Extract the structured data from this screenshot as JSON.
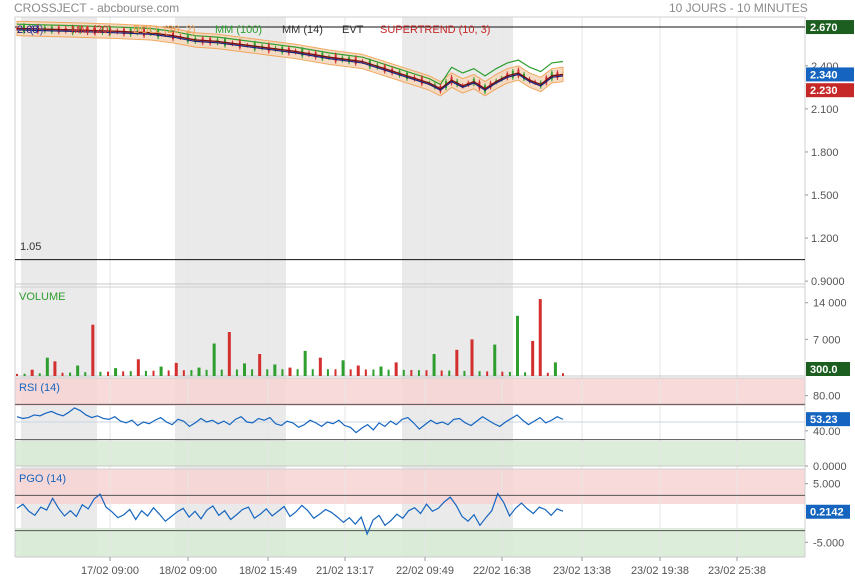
{
  "header": {
    "source": "CROSSJECT - abcbourse.com",
    "period": "10 JOURS - 10 MINUTES"
  },
  "indicators": [
    {
      "label": "2.68",
      "color": "#1a237e"
    },
    {
      "label": "(7)",
      "color": "#3949ab"
    },
    {
      "label": "MM (20)",
      "color": "#d32f2f"
    },
    {
      "label": "BOLL (20, 2)",
      "color": "#f0a050"
    },
    {
      "label": "MM (100)",
      "color": "#2e9e2e"
    },
    {
      "label": "MM (14)",
      "color": "#333333"
    },
    {
      "label": "EVT",
      "color": "#333333"
    },
    {
      "label": "SUPERTREND (10, 3)",
      "color": "#c62828"
    }
  ],
  "price_ref_label": "1.05",
  "price_badges": [
    {
      "value": "2.670",
      "bg": "#1b5e20"
    },
    {
      "value": "2.340",
      "bg": "#1565c0"
    },
    {
      "value": "2.230",
      "bg": "#c62828"
    }
  ],
  "volume_badge": {
    "value": "300.0",
    "bg": "#1b5e20"
  },
  "rsi_badge": {
    "value": "53.23",
    "bg": "#1565c0"
  },
  "pgo_badge": {
    "value": "0.2142",
    "bg": "#1565c0"
  },
  "panels": {
    "volume_title": "VOLUME",
    "rsi_title": "RSI (14)",
    "pgo_title": "PGO (14)"
  },
  "colors": {
    "up": "#2e9e2e",
    "down": "#d32f2f",
    "rsi_line": "#1565c0",
    "shade": "#e3e3e3",
    "overbought": "#f8d4d4",
    "oversold": "#d8ecd6"
  },
  "chart_data": [
    {
      "type": "line",
      "name": "price",
      "yticks": [
        "2.400",
        "2.100",
        "1.800",
        "1.500",
        "1.200",
        "0.9000"
      ],
      "ylim": [
        0.88,
        2.74
      ],
      "xticks": [
        "17/02 09:00",
        "18/02 09:00",
        "18/02 15:49",
        "21/02 13:17",
        "22/02 09:49",
        "22/02 16:38",
        "23/02 13:38",
        "23/02 19:38",
        "23/02 25:38"
      ],
      "reference_lines": [
        2.67,
        1.05
      ],
      "approx_close_path": [
        [
          0,
          2.66
        ],
        [
          5,
          2.65
        ],
        [
          9,
          2.64
        ],
        [
          12,
          2.63
        ],
        [
          14,
          2.61
        ],
        [
          16,
          2.58
        ],
        [
          18,
          2.57
        ],
        [
          20,
          2.55
        ],
        [
          22,
          2.53
        ],
        [
          25,
          2.5
        ],
        [
          28,
          2.46
        ],
        [
          31,
          2.43
        ],
        [
          33,
          2.38
        ],
        [
          35,
          2.33
        ],
        [
          37,
          2.28
        ],
        [
          38,
          2.24
        ],
        [
          39,
          2.3
        ],
        [
          40,
          2.26
        ],
        [
          41,
          2.29
        ],
        [
          42,
          2.24
        ],
        [
          43,
          2.29
        ],
        [
          44,
          2.33
        ],
        [
          45,
          2.35
        ],
        [
          46,
          2.3
        ],
        [
          47,
          2.27
        ],
        [
          48,
          2.33
        ],
        [
          49,
          2.34
        ]
      ]
    },
    {
      "type": "bar",
      "name": "VOLUME",
      "yticks": [
        "14 000",
        "7 000"
      ],
      "ylim": [
        0,
        17000
      ],
      "bars": [
        [
          2,
          1200,
          "down"
        ],
        [
          4,
          3500,
          "up"
        ],
        [
          5,
          2800,
          "down"
        ],
        [
          8,
          2000,
          "up"
        ],
        [
          10,
          9800,
          "down"
        ],
        [
          13,
          1500,
          "up"
        ],
        [
          16,
          3200,
          "down"
        ],
        [
          19,
          1800,
          "up"
        ],
        [
          21,
          2500,
          "down"
        ],
        [
          24,
          1600,
          "up"
        ],
        [
          26,
          6200,
          "up"
        ],
        [
          28,
          8400,
          "down"
        ],
        [
          30,
          2400,
          "up"
        ],
        [
          32,
          4200,
          "down"
        ],
        [
          34,
          2200,
          "up"
        ],
        [
          36,
          1600,
          "down"
        ],
        [
          38,
          4800,
          "up"
        ],
        [
          40,
          3500,
          "down"
        ],
        [
          43,
          3000,
          "up"
        ],
        [
          45,
          2000,
          "down"
        ],
        [
          48,
          1800,
          "up"
        ],
        [
          50,
          2600,
          "down"
        ],
        [
          55,
          4200,
          "up"
        ],
        [
          58,
          5000,
          "down"
        ],
        [
          60,
          7000,
          "down"
        ],
        [
          63,
          6000,
          "up"
        ],
        [
          66,
          11500,
          "up"
        ],
        [
          68,
          6700,
          "down"
        ],
        [
          69,
          14700,
          "down"
        ],
        [
          71,
          2600,
          "up"
        ]
      ]
    },
    {
      "type": "line",
      "name": "RSI (14)",
      "yticks": [
        "80.00",
        "40.00",
        "0.0000"
      ],
      "ylim": [
        0,
        100
      ],
      "thresholds": [
        70,
        30
      ],
      "values": [
        56,
        54,
        55,
        58,
        57,
        60,
        62,
        59,
        57,
        61,
        66,
        63,
        58,
        55,
        57,
        54,
        53,
        56,
        51,
        49,
        52,
        46,
        50,
        48,
        52,
        55,
        50,
        47,
        53,
        51,
        45,
        49,
        54,
        50,
        52,
        48,
        51,
        47,
        53,
        56,
        50,
        49,
        54,
        52,
        55,
        48,
        46,
        51,
        49,
        44,
        47,
        52,
        49,
        45,
        50,
        48,
        52,
        46,
        44,
        38,
        43,
        47,
        41,
        49,
        45,
        51,
        47,
        53,
        55,
        49,
        42,
        47,
        52,
        48,
        50,
        47,
        53,
        54,
        49,
        46,
        51,
        56,
        52,
        48,
        45,
        50,
        54,
        58,
        52,
        47,
        51,
        55,
        49,
        52,
        56,
        53
      ]
    },
    {
      "type": "line",
      "name": "PGO (14)",
      "yticks": [
        "5.000",
        "-5.000"
      ],
      "ylim": [
        -7.5,
        7.5
      ],
      "thresholds": [
        3,
        -3
      ],
      "values": [
        0.8,
        1.5,
        0.3,
        -0.4,
        1.0,
        0.5,
        2.5,
        0.8,
        -0.5,
        0.4,
        -0.6,
        1.4,
        0.7,
        2.4,
        3.2,
        1.0,
        0.2,
        -0.8,
        -0.3,
        0.6,
        -1.1,
        0.4,
        -0.5,
        0.9,
        -0.2,
        -1.4,
        -0.6,
        0.2,
        0.8,
        -0.7,
        0.3,
        -1.0,
        0.5,
        1.2,
        -0.4,
        0.4,
        -1.1,
        -0.3,
        0.6,
        1.0,
        -0.9,
        -0.2,
        0.7,
        -0.5,
        0.3,
        1.1,
        -0.6,
        0.2,
        1.3,
        0.4,
        -0.9,
        -0.2,
        0.6,
        0.1,
        -0.7,
        -1.6,
        -0.8,
        -1.9,
        -0.7,
        -3.6,
        -1.2,
        -0.4,
        -2.1,
        -1.3,
        -0.2,
        -0.9,
        0.4,
        0.9,
        -0.1,
        1.5,
        0.3,
        0.8,
        1.9,
        2.7,
        1.3,
        -0.6,
        -1.4,
        -0.3,
        -2.1,
        -0.8,
        0.4,
        3.3,
        1.8,
        -0.5,
        0.8,
        1.7,
        0.7,
        -0.1,
        1.0,
        0.6,
        -0.4,
        0.7,
        0.3
      ]
    }
  ]
}
